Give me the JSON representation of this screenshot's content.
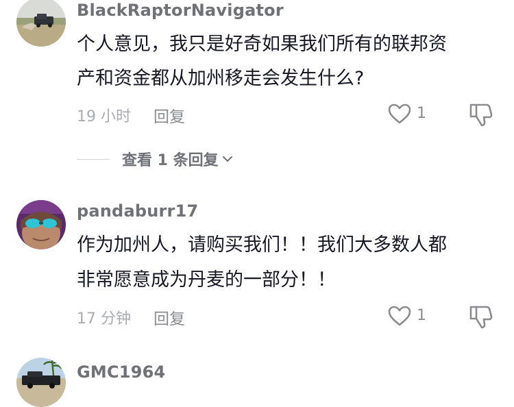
{
  "comments": [
    {
      "username": "BlackRaptorNavigator",
      "text_lines": [
        "个人意见，我只是好奇如果我们所有的联邦资",
        "产和资金都从加州移走会发生什么?"
      ],
      "time": "19 小时",
      "reply_label": "回复",
      "likes": "1",
      "avatar_icon": "truck-in-field-avatar"
    },
    {
      "username": "pandaburr17",
      "text_lines": [
        "作为加州人，请购买我们！！我们大多数人都",
        "非常愿意成为丹麦的一部分！！"
      ],
      "time": "17 分钟",
      "reply_label": "回复",
      "likes": "1",
      "avatar_icon": "person-with-sunglasses-avatar"
    },
    {
      "username": "GMC1964",
      "avatar_icon": "pickup-truck-avatar"
    }
  ],
  "view_replies": {
    "label": "查看 1 条回复"
  },
  "colors": {
    "username": "#6f7177",
    "text": "#161823",
    "meta": "#a9abb0",
    "icon": "#8a8b91"
  }
}
